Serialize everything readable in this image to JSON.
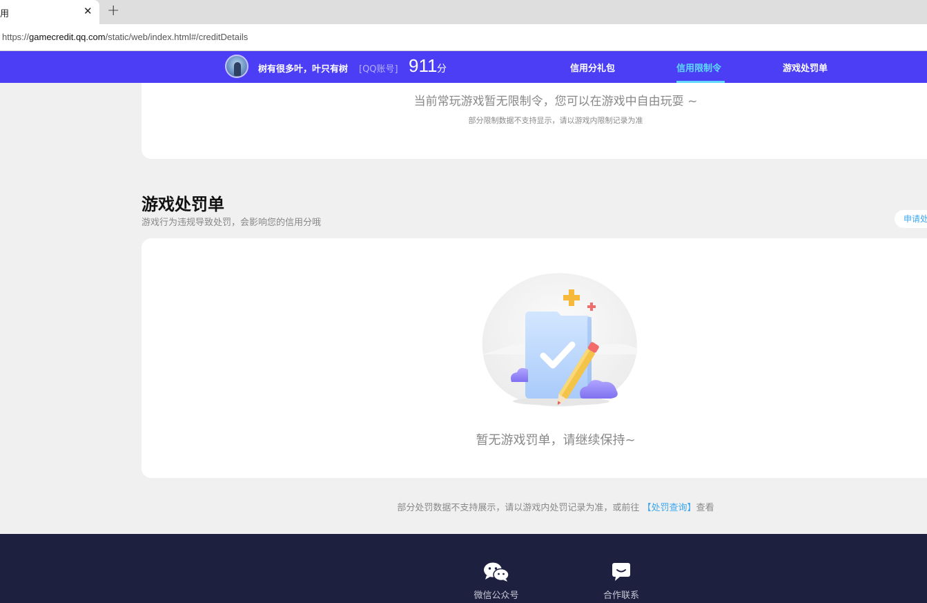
{
  "browser": {
    "tab_title": "用",
    "close_glyph": "✕",
    "new_tab_glyph": "+",
    "url_prefix": "https://",
    "url_host": "gamecredit.qq.com",
    "url_path": "/static/web/index.html#/creditDetails"
  },
  "header": {
    "nickname": "树有很多叶，叶只有树",
    "account_type": "[QQ账号]",
    "score": "911",
    "score_unit": "分",
    "nav": [
      {
        "label": "信用分礼包",
        "active": false
      },
      {
        "label": "信用限制令",
        "active": true
      },
      {
        "label": "游戏处罚单",
        "active": false
      }
    ],
    "accent_color": "#4b3ef5",
    "active_color": "#5fd9ff"
  },
  "restriction": {
    "message": "当前常玩游戏暂无限制令，您可以在游戏中自由玩耍 ~",
    "note": "部分限制数据不支持显示，请以游戏内限制记录为准"
  },
  "penalty": {
    "title": "游戏处罚单",
    "subtitle": "游戏行为违规导致处罚，会影响您的信用分哦",
    "apply_button": "申请处",
    "empty_message": "暂无游戏罚单，请继续保持~",
    "illustration_icon": "clipboard-check-pencil-icon"
  },
  "bottom_note": {
    "prefix": "部分处罚数据不支持展示，请以游戏内处罚记录为准，或前往 ",
    "link": "【处罚查询】",
    "suffix": "查看"
  },
  "footer": {
    "items": [
      {
        "label": "微信公众号",
        "icon": "wechat-icon"
      },
      {
        "label": "合作联系",
        "icon": "chat-bubble-icon"
      }
    ]
  }
}
